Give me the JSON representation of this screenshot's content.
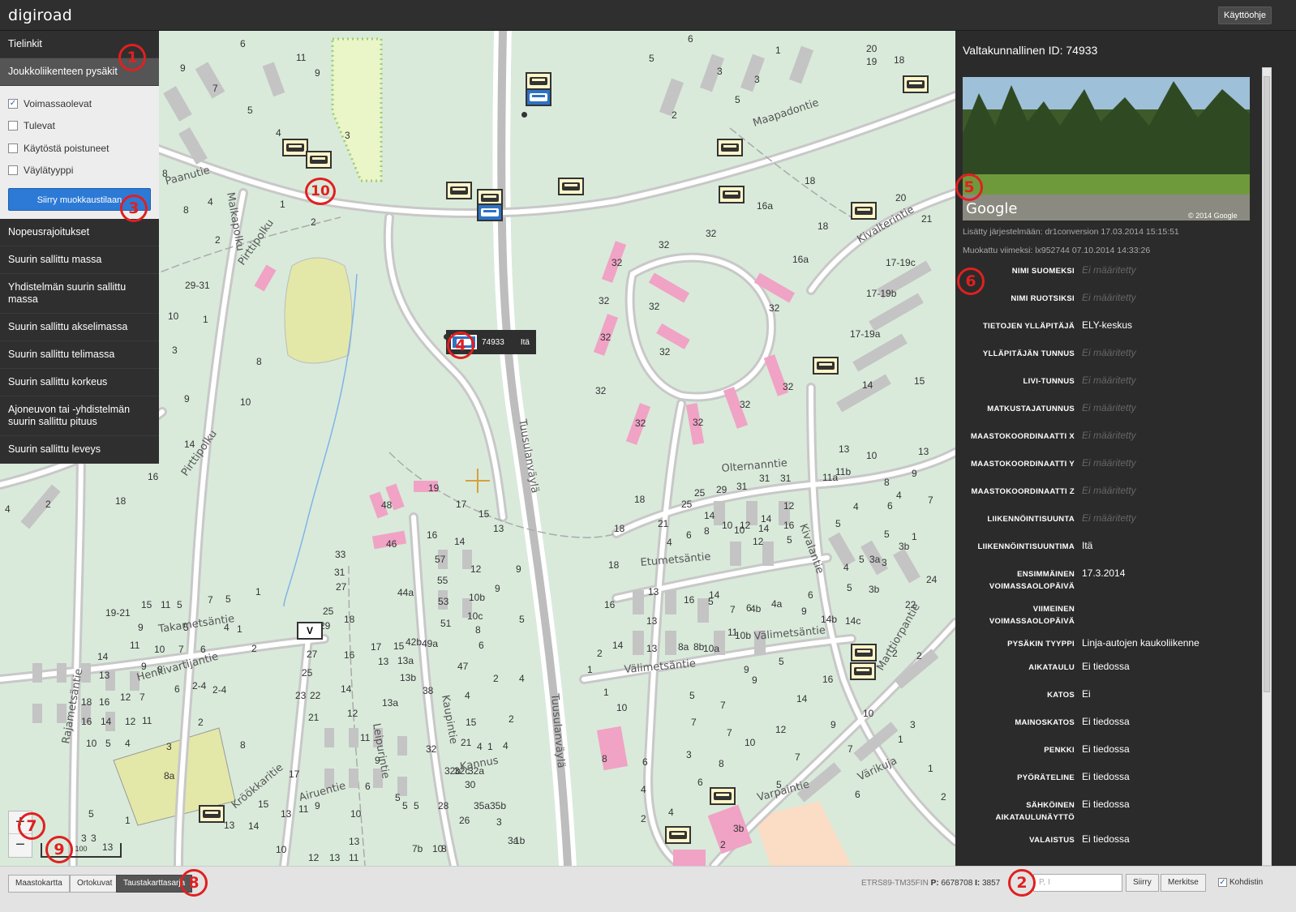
{
  "app": {
    "logo": "digiroad",
    "help_label": "Käyttöohje"
  },
  "left_nav": {
    "top_items": [
      {
        "label": "Tielinkit"
      },
      {
        "label": "Joukkoliikenteen pysäkit"
      }
    ],
    "filters": [
      {
        "label": "Voimassaolevat",
        "checked": true
      },
      {
        "label": "Tulevat",
        "checked": false
      },
      {
        "label": "Käytöstä poistuneet",
        "checked": false
      },
      {
        "label": "Väylätyyppi",
        "checked": false
      }
    ],
    "edit_button": "Siirry muokkaustilaan",
    "lower_items": [
      {
        "label": "Nopeusrajoitukset"
      },
      {
        "label": "Suurin sallittu massa"
      },
      {
        "label": "Yhdistelmän suurin sallittu massa"
      },
      {
        "label": "Suurin sallittu akselimassa"
      },
      {
        "label": "Suurin sallittu telimassa"
      },
      {
        "label": "Suurin sallittu korkeus"
      },
      {
        "label": "Ajoneuvon tai -yhdistelmän suurin sallittu pituus"
      },
      {
        "label": "Suurin sallittu leveys"
      }
    ]
  },
  "map": {
    "tooltip": {
      "id": "74933",
      "direction": "Itä"
    },
    "zoom_in": "+",
    "zoom_out": "−",
    "scale_label": "100",
    "v_marker": "V",
    "street_labels": [
      "Tuusulanväylä",
      "Tuusulanväylä",
      "Takametsäntie",
      "Henkivartijantie",
      "Rajametsäntie",
      "Maapadontie",
      "Kivalterintie",
      "Olternanntie",
      "Etumetsäntie",
      "Välimetsäntie",
      "Pirttipolku",
      "Malkapolku",
      "Paanutie",
      "Airuentie",
      "Kröökkaritie",
      "Leipurintie",
      "Kannus",
      "Kaupintie",
      "Värikuja",
      "Varpaintie",
      "Airuentie"
    ],
    "address_numbers": [
      "6",
      "11",
      "13",
      "9",
      "7",
      "5",
      "4",
      "3",
      "8",
      "10",
      "2",
      "9",
      "20",
      "18",
      "32",
      "32",
      "32",
      "32",
      "32",
      "32",
      "32",
      "32",
      "32",
      "17-19c",
      "17-19b",
      "17-19a",
      "16a",
      "16a",
      "18",
      "21",
      "14",
      "15",
      "19",
      "17",
      "15",
      "16",
      "14",
      "13",
      "12",
      "10b",
      "10c",
      "9",
      "9",
      "57",
      "55",
      "53",
      "51",
      "49a",
      "47",
      "46",
      "48",
      "44a",
      "42b",
      "38",
      "33",
      "31",
      "29",
      "27",
      "25",
      "23",
      "21",
      "19",
      "17",
      "16",
      "14",
      "12",
      "11",
      "9",
      "8",
      "7",
      "6",
      "5",
      "4",
      "3",
      "2",
      "1"
    ],
    "colors": {
      "background": "#d9eadb",
      "building": "#f0a3c4",
      "road": "#ffffff"
    }
  },
  "info_panel": {
    "title": "Valtakunnallinen ID: 74933",
    "photo_watermark": "© 2014 Google",
    "photo_brand": "Google",
    "added": "Lisätty järjestelmään: dr1conversion 17.03.2014 15:15:51",
    "modified": "Muokattu viimeksi: lx952744 07.10.2014 14:33:26",
    "properties": [
      {
        "label": "NIMI SUOMEKSI",
        "value": "Ei määritetty",
        "empty": true
      },
      {
        "label": "NIMI RUOTSIKSI",
        "value": "Ei määritetty",
        "empty": true
      },
      {
        "label": "TIETOJEN YLLÄPITÄJÄ",
        "value": "ELY-keskus",
        "empty": false
      },
      {
        "label": "YLLÄPITÄJÄN TUNNUS",
        "value": "Ei määritetty",
        "empty": true
      },
      {
        "label": "LIVI-TUNNUS",
        "value": "Ei määritetty",
        "empty": true
      },
      {
        "label": "MATKUSTAJATUNNUS",
        "value": "Ei määritetty",
        "empty": true
      },
      {
        "label": "MAASTOKOORDINAATTI X",
        "value": "Ei määritetty",
        "empty": true
      },
      {
        "label": "MAASTOKOORDINAATTI Y",
        "value": "Ei määritetty",
        "empty": true
      },
      {
        "label": "MAASTOKOORDINAATTI Z",
        "value": "Ei määritetty",
        "empty": true
      },
      {
        "label": "LIIKENNÖINTISUUNTA",
        "value": "Ei määritetty",
        "empty": true
      },
      {
        "label": "LIIKENNÖINTISUUNTIMA",
        "value": "Itä",
        "empty": false
      },
      {
        "label": "ENSIMMÄINEN VOIMASSAOLOPÄIVÄ",
        "value": "17.3.2014",
        "empty": false
      },
      {
        "label": "VIIMEINEN VOIMASSAOLOPÄIVÄ",
        "value": "",
        "empty": false
      },
      {
        "label": "PYSÄKIN TYYPPI",
        "value": "Linja-autojen kaukoliikenne",
        "empty": false
      },
      {
        "label": "AIKATAULU",
        "value": "Ei tiedossa",
        "empty": false
      },
      {
        "label": "KATOS",
        "value": "Ei",
        "empty": false
      },
      {
        "label": "MAINOSKATOS",
        "value": "Ei tiedossa",
        "empty": false
      },
      {
        "label": "PENKKI",
        "value": "Ei tiedossa",
        "empty": false
      },
      {
        "label": "PYÖRÄTELINE",
        "value": "Ei tiedossa",
        "empty": false
      },
      {
        "label": "SÄHKÖINEN AIKATAULUNÄYTTÖ",
        "value": "Ei tiedossa",
        "empty": false
      },
      {
        "label": "VALAISTUS",
        "value": "Ei tiedossa",
        "empty": false
      }
    ]
  },
  "bottom_bar": {
    "background_buttons": [
      {
        "label": "Maastokartta",
        "active": false
      },
      {
        "label": "Ortokuvat",
        "active": false
      },
      {
        "label": "Taustakarttasarja",
        "active": true
      }
    ],
    "coord_system": "ETRS89-TM35FIN",
    "p_label": "P:",
    "p_value": "6678708",
    "i_label": "I:",
    "i_value": "3857",
    "input_placeholder": "P, I",
    "go_button": "Siirry",
    "mark_button": "Merkitse",
    "crosshair_label": "Kohdistin",
    "crosshair_checked": true
  },
  "annotations": [
    "1",
    "2",
    "3",
    "4",
    "5",
    "6",
    "7",
    "8",
    "9",
    "10"
  ]
}
